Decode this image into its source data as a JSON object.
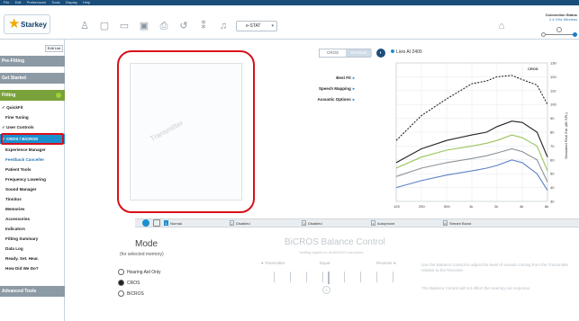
{
  "menu": [
    "File",
    "Edit",
    "Preferences",
    "Tools",
    "Display",
    "Help"
  ],
  "app": {
    "logo_text": "Starkey"
  },
  "toolbar": {
    "icons": [
      "patient-icon",
      "new-icon",
      "open-icon",
      "save-icon",
      "print-icon",
      "undo-icon",
      "remote-icon",
      "music-icon"
    ],
    "program_select": "e-STAT"
  },
  "connection": {
    "title": "Connection Status",
    "subtitle": "2.4 GHz Wireless"
  },
  "sidebar": {
    "edit_list": "Edit List",
    "sections": [
      {
        "label": "Pre-Fitting"
      },
      {
        "label": "Get Started"
      },
      {
        "label": "Fitting"
      }
    ],
    "fitting_items": [
      "✓ QuickFit",
      "Fine Tuning",
      "✓ User Controls",
      "✓ CROS / BiCROS",
      "Experience Manager",
      "Feedback Canceller",
      "Patient Tools",
      "Frequency Lowering",
      "Sound Manager",
      "Tinnitus",
      "Memories",
      "Accessories",
      "Indicators",
      "Fitting Summary",
      "Data Log",
      "Ready. Set. Hear.",
      "How Did We Do?"
    ],
    "advanced": "Advanced Tools"
  },
  "transmitter": {
    "label": "Transmitter"
  },
  "tabs": {
    "cros": "CROS",
    "receiver": "Receiver"
  },
  "device_model": "Livio AI 2400",
  "options": [
    {
      "label": "Best Fit"
    },
    {
      "label": "Speech Mapping"
    },
    {
      "label": "Acoustic Options"
    }
  ],
  "colors": {
    "highlight": "#d8101a",
    "accent": "#1a8fd0",
    "curve_black": "#222222",
    "curve_green": "#9ac45a",
    "curve_gray": "#8c9298",
    "curve_blue": "#5a7fc6"
  },
  "chart_data": {
    "type": "line",
    "legend_text": "CROS",
    "ylabel": "Simulated Real Ear (dB SPL)",
    "ylim": [
      30,
      130
    ],
    "yticks": [
      30,
      40,
      50,
      60,
      70,
      80,
      90,
      100,
      110,
      120,
      130
    ],
    "xticks": [
      "125",
      "250",
      "500",
      "1k",
      "2k",
      "4k",
      "8k"
    ],
    "x": [
      125,
      250,
      500,
      1000,
      1500,
      2000,
      3000,
      4000,
      6000,
      8000
    ],
    "series": [
      {
        "color": "#222222",
        "dashed": true,
        "values": [
          74,
          92,
          104,
          115,
          117,
          120,
          121,
          118,
          114,
          100
        ]
      },
      {
        "color": "#222222",
        "dashed": false,
        "values": [
          58,
          68,
          74,
          78,
          80,
          84,
          88,
          87,
          80,
          62
        ]
      },
      {
        "color": "#9ac45a",
        "dashed": false,
        "values": [
          54,
          62,
          67,
          70,
          72,
          74,
          78,
          76,
          70,
          52
        ]
      },
      {
        "color": "#8c9298",
        "dashed": false,
        "values": [
          48,
          54,
          58,
          61,
          63,
          65,
          68,
          66,
          60,
          44
        ]
      },
      {
        "color": "#5a7fc6",
        "dashed": false,
        "values": [
          40,
          45,
          49,
          52,
          54,
          56,
          60,
          58,
          50,
          38
        ]
      }
    ],
    "grid": true
  },
  "control_bar": {
    "memory": {
      "num": "1",
      "label": "Normal"
    },
    "item2": {
      "num": "2",
      "label": "Disabled"
    },
    "item3": {
      "num": "3",
      "label": "Disabled"
    },
    "item4": {
      "num": "4",
      "label": "Autophone"
    },
    "item5": {
      "num": "8",
      "label": "Stream Boost"
    }
  },
  "mode": {
    "title": "Mode",
    "subtitle": "(for selected memory)",
    "options": [
      "Hearing Aid Only",
      "CROS",
      "BiCROS"
    ],
    "selected": "CROS"
  },
  "balance": {
    "title": "BiCROS Balance Control",
    "subtitle": "*setting applies to all BiCROS memories",
    "left": "Transmitter",
    "center": "Equal",
    "right": "Receiver",
    "note1": "Use the Balance Control to adjust the level of sounds coming from the Transmitter relative to the Receiver.",
    "note2": "The Balance Control will not affect the Hearing Aid response."
  }
}
